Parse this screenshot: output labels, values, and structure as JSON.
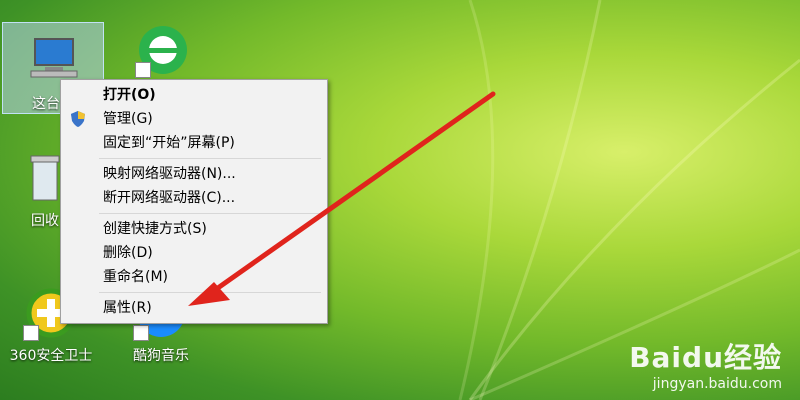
{
  "desktop": {
    "icons": [
      {
        "label": "这台电"
      },
      {
        "label": ""
      },
      {
        "label": "回收"
      },
      {
        "label": "360安全卫士"
      },
      {
        "label": "酷狗音乐"
      }
    ]
  },
  "context_menu": {
    "items": [
      {
        "label": "打开(O)"
      },
      {
        "label": "管理(G)"
      },
      {
        "label": "固定到“开始”屏幕(P)"
      },
      {
        "label": "映射网络驱动器(N)..."
      },
      {
        "label": "断开网络驱动器(C)..."
      },
      {
        "label": "创建快捷方式(S)"
      },
      {
        "label": "删除(D)"
      },
      {
        "label": "重命名(M)"
      },
      {
        "label": "属性(R)"
      }
    ]
  },
  "watermark": {
    "top": "Baidu经验",
    "bottom": "jingyan.baidu.com"
  },
  "colors": {
    "arrow": "#e0241c",
    "menu_bg": "#f2f2f2",
    "selection": "#b4d2eb"
  }
}
